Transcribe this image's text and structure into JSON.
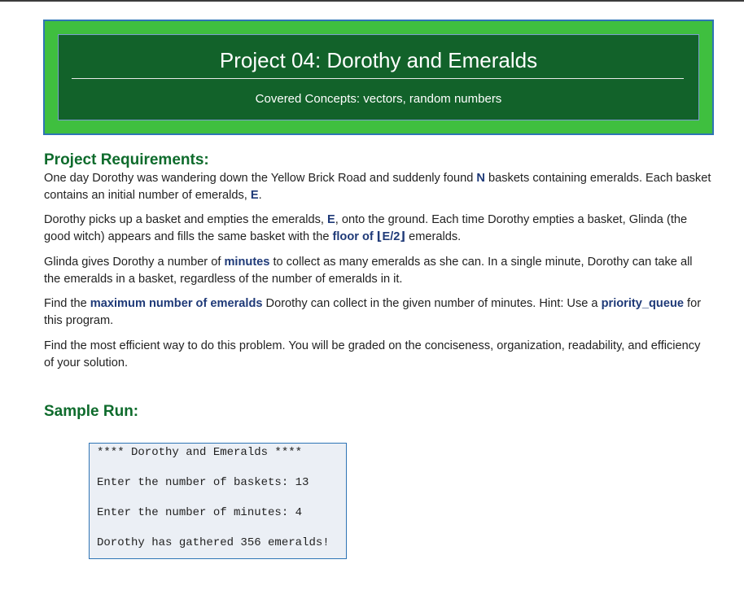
{
  "banner": {
    "title": "Project 04:  Dorothy and Emeralds",
    "subtitle": "Covered Concepts:  vectors, random numbers"
  },
  "requirements": {
    "heading": "Project Requirements:",
    "p1": {
      "t1": "One day Dorothy was wandering down the Yellow Brick Road and suddenly found ",
      "b1": "N",
      "t2": " baskets containing emeralds.   Each basket contains an initial number of emeralds, ",
      "b2": "E",
      "t3": "."
    },
    "p2": {
      "t1": "Dorothy picks up a basket and empties the emeralds, ",
      "b1": "E",
      "t2": ", onto the ground.  Each time Dorothy empties a basket, Glinda (the good witch) appears and fills the same basket with the ",
      "b2": "floor of ⌊E/2⌋",
      "t3": " emeralds."
    },
    "p3": {
      "t1": "Glinda gives Dorothy a number of ",
      "b1": "minutes",
      "t2": " to collect as many emeralds as she can.  In a single minute, Dorothy can take all the emeralds in a basket, regardless of the number of emeralds in it."
    },
    "p4": {
      "t1": "Find the ",
      "b1": "maximum number of emeralds",
      "t2": " Dorothy can collect in the given number of minutes.  Hint:  Use a ",
      "b2": "priority_queue",
      "t3": " for this program."
    },
    "p5": "Find the most efficient way to do this problem.  You will be graded on the conciseness, organization, readability, and efficiency of your solution."
  },
  "sample": {
    "heading": "Sample Run:",
    "lines": [
      "**** Dorothy and Emeralds ****",
      "Enter the number of baskets: 13",
      "Enter the number of minutes: 4",
      "Dorothy has gathered 356 emeralds!"
    ]
  }
}
